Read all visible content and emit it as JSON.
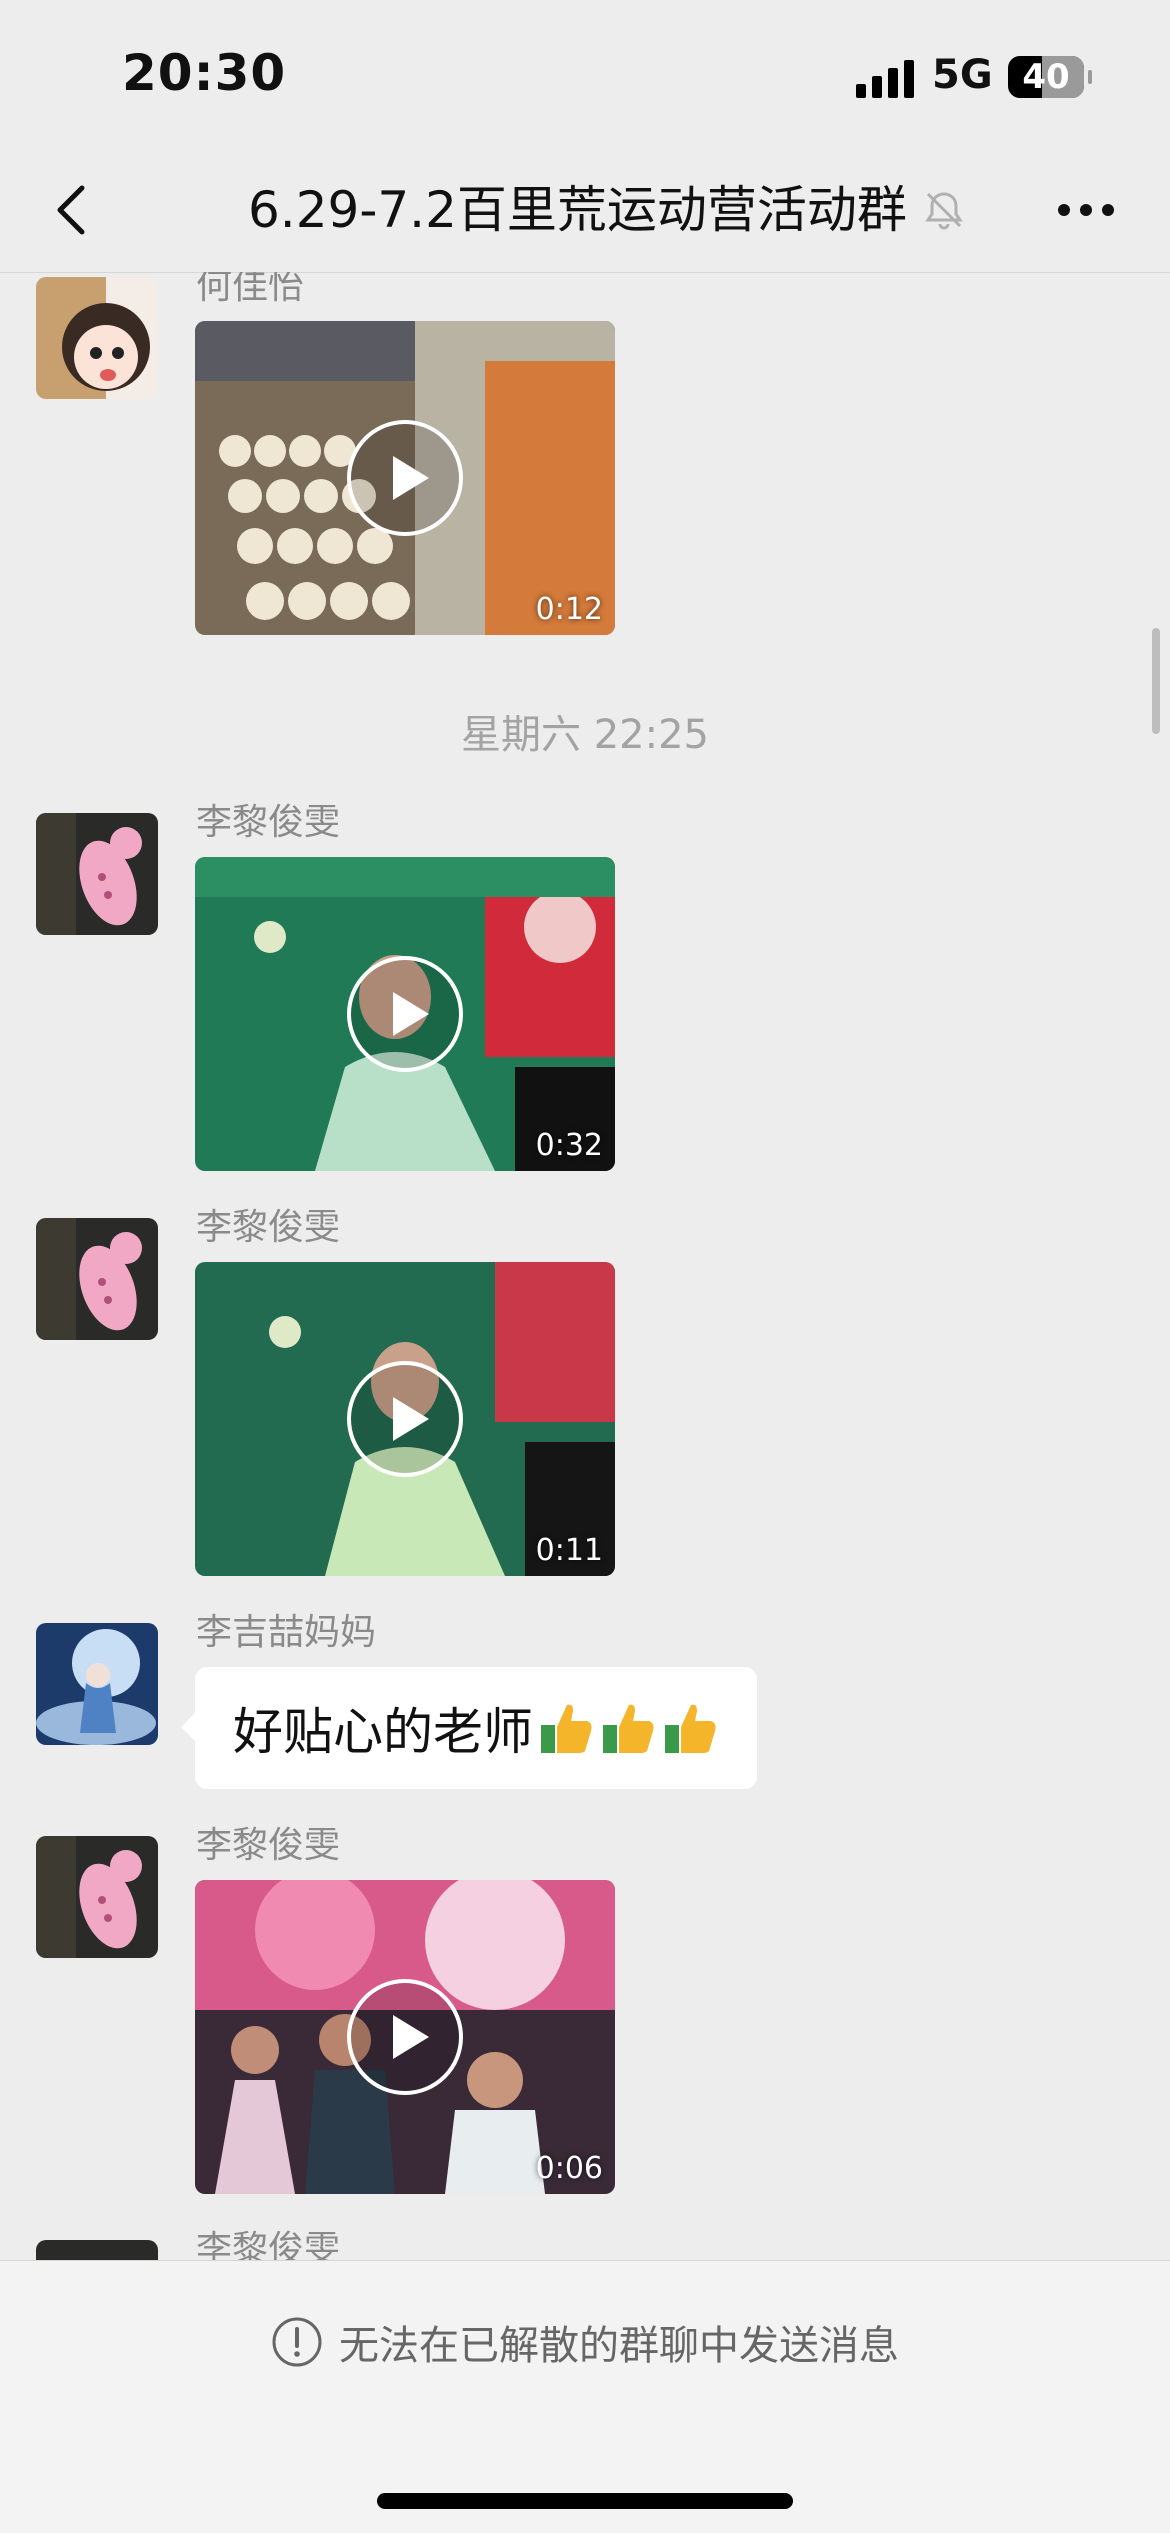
{
  "status_bar": {
    "time": "20:30",
    "network": "5G",
    "battery": "40"
  },
  "header": {
    "back_icon": "chevron-left-icon",
    "title": "6.29-7.2百里荒运动营活动群",
    "mute_icon": "bell-slash-icon",
    "more_icon": "ellipsis-icon"
  },
  "messages": [
    {
      "sender": "何佳怡",
      "type": "video",
      "duration": "0:12"
    },
    {
      "type": "timestamp",
      "text": "星期六 22:25"
    },
    {
      "sender": "李黎俊雯",
      "type": "video",
      "duration": "0:32"
    },
    {
      "sender": "李黎俊雯",
      "type": "video",
      "duration": "0:11"
    },
    {
      "sender": "李吉喆妈妈",
      "type": "text",
      "text": "好贴心的老师",
      "emoji": [
        "thumbs-up",
        "thumbs-up",
        "thumbs-up"
      ]
    },
    {
      "sender": "李黎俊雯",
      "type": "video",
      "duration": "0:06"
    },
    {
      "sender": "李黎俊雯",
      "type": "partial"
    }
  ],
  "footer": {
    "info_icon": "exclamation-circle-icon",
    "notice": "无法在已解散的群聊中发送消息"
  },
  "colors": {
    "background": "#ededed",
    "bubble": "#ffffff",
    "muted_text": "#8a8a8a"
  }
}
